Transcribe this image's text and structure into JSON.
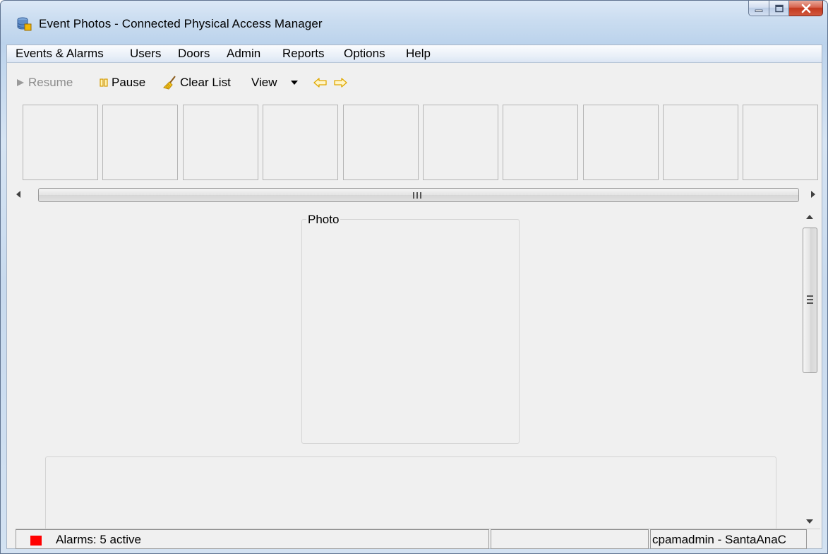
{
  "window": {
    "title": "Event Photos - Connected Physical Access Manager"
  },
  "menu": [
    "Events & Alarms",
    "Users",
    "Doors",
    "Admin",
    "Reports",
    "Options",
    "Help"
  ],
  "toolbar": {
    "resume_label": "Resume",
    "pause_label": "Pause",
    "clear_list_label": "Clear List",
    "view_label": "View"
  },
  "hscroll": {
    "grip": "III"
  },
  "photo": {
    "group_label": "Photo"
  },
  "status": {
    "alarms_text": "Alarms: 5 active",
    "user_text": "cpamadmin - SantaAnaC",
    "alarm_color": "#ff0000"
  },
  "colors": {
    "arrow_accent": "#f2b705",
    "pause_accent": "#e0a800"
  },
  "icons": [
    "app-database-icon",
    "play-icon",
    "pause-icon",
    "broom-icon",
    "dropdown-arrow-icon",
    "back-arrow-icon",
    "forward-arrow-icon"
  ]
}
